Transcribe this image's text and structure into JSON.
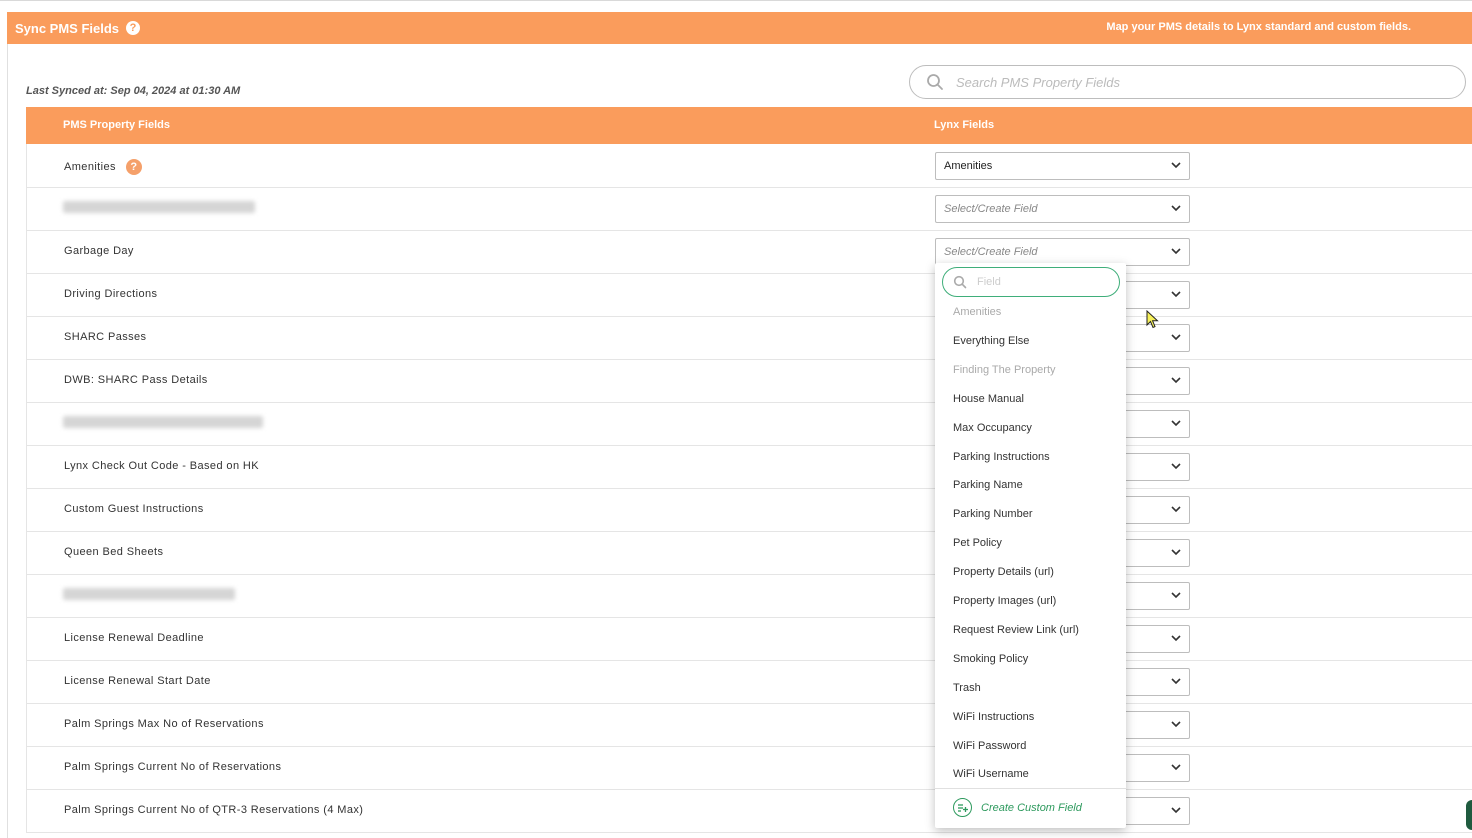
{
  "header": {
    "title": "Sync PMS Fields",
    "help": "?",
    "subtitle": "Map your PMS details to Lynx standard and custom fields."
  },
  "last_synced": "Last Synced at: Sep 04, 2024 at 01:30 AM",
  "search": {
    "placeholder": "Search PMS Property Fields"
  },
  "table": {
    "col_pms": "PMS Property Fields",
    "col_lynx": "Lynx Fields"
  },
  "rows": [
    {
      "label": "Amenities",
      "help": "?",
      "value": "Amenities"
    },
    {
      "label": "",
      "value": "Select/Create Field"
    },
    {
      "label": "Garbage Day",
      "value": "Select/Create Field"
    },
    {
      "label": "Driving Directions",
      "value": ""
    },
    {
      "label": "SHARC Passes",
      "value": ""
    },
    {
      "label": "DWB: SHARC Pass Details",
      "value": ""
    },
    {
      "label": "",
      "value": ""
    },
    {
      "label": "Lynx Check Out Code - Based on HK",
      "value": ""
    },
    {
      "label": "Custom Guest Instructions",
      "value": ""
    },
    {
      "label": "Queen Bed Sheets",
      "value": ""
    },
    {
      "label": "",
      "value": ""
    },
    {
      "label": "License Renewal Deadline",
      "value": ""
    },
    {
      "label": "License Renewal Start Date",
      "value": ""
    },
    {
      "label": "Palm Springs Max No of Reservations",
      "value": ""
    },
    {
      "label": "Palm Springs Current No of Reservations",
      "value": ""
    },
    {
      "label": "Palm Springs Current No of QTR-3 Reservations (4 Max)",
      "value": ""
    }
  ],
  "dropdown": {
    "search_placeholder": "Field",
    "items": [
      {
        "label": "Amenities",
        "disabled": true
      },
      {
        "label": "Everything Else",
        "disabled": false
      },
      {
        "label": "Finding The Property",
        "disabled": true
      },
      {
        "label": "House Manual",
        "disabled": false
      },
      {
        "label": "Max Occupancy",
        "disabled": false
      },
      {
        "label": "Parking Instructions",
        "disabled": false
      },
      {
        "label": "Parking Name",
        "disabled": false
      },
      {
        "label": "Parking Number",
        "disabled": false
      },
      {
        "label": "Pet Policy",
        "disabled": false
      },
      {
        "label": "Property Details (url)",
        "disabled": false
      },
      {
        "label": "Property Images (url)",
        "disabled": false
      },
      {
        "label": "Request Review Link (url)",
        "disabled": false
      },
      {
        "label": "Smoking Policy",
        "disabled": false
      },
      {
        "label": "Trash",
        "disabled": false
      },
      {
        "label": "WiFi Instructions",
        "disabled": false
      },
      {
        "label": "WiFi Password",
        "disabled": false
      },
      {
        "label": "WiFi Username",
        "disabled": false
      }
    ],
    "create_label": "Create Custom Field"
  },
  "colors": {
    "accent": "#fa9c5c",
    "create_green": "#2e9a5e"
  }
}
